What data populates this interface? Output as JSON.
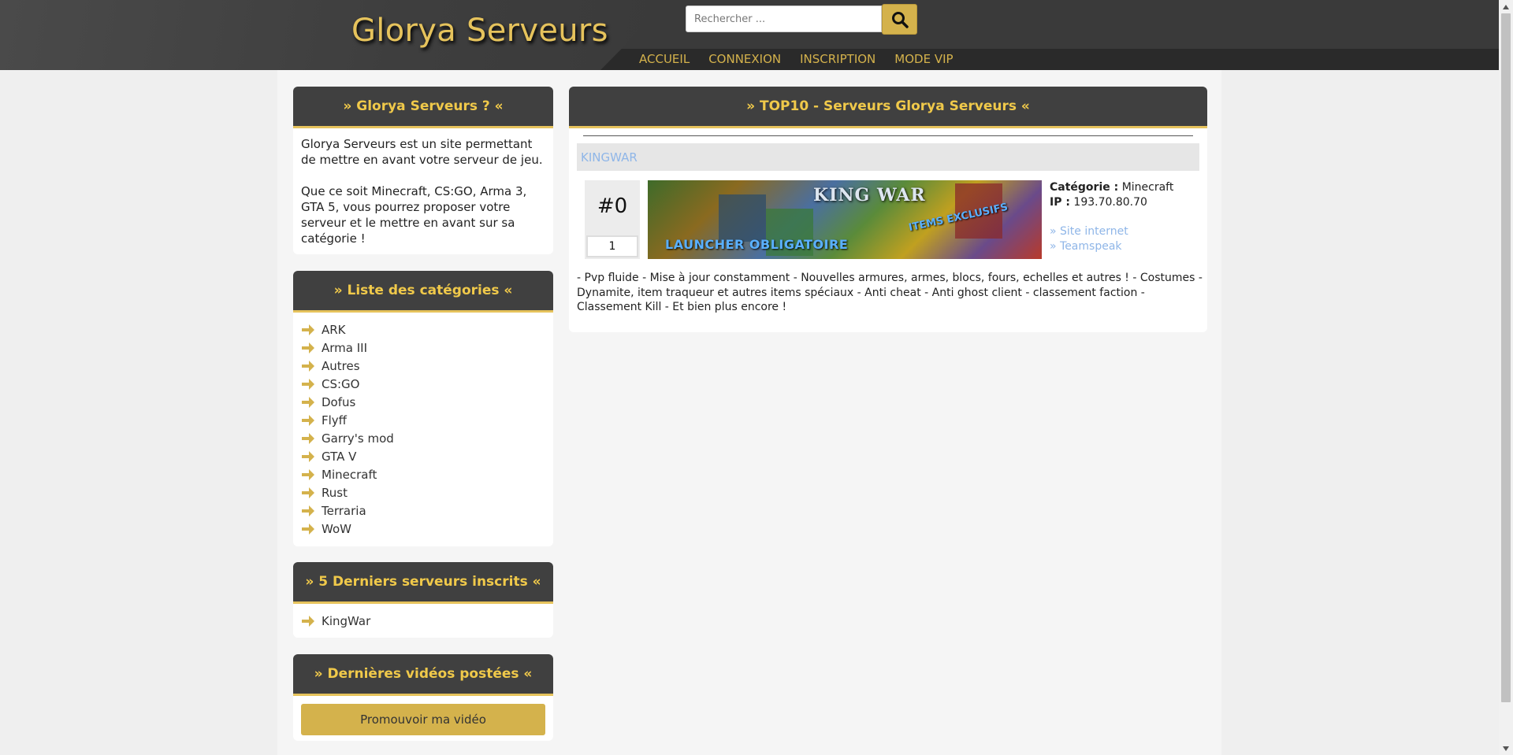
{
  "header": {
    "site_title": "Glorya Serveurs",
    "search_placeholder": "Rechercher ...",
    "nav": [
      "ACCUEIL",
      "CONNEXION",
      "INSCRIPTION",
      "MODE VIP"
    ]
  },
  "sidebar": {
    "about": {
      "title": "» Glorya Serveurs ? «",
      "paragraph1": "Glorya Serveurs est un site permettant de mettre en avant votre serveur de jeu.",
      "paragraph2": "Que ce soit Minecraft, CS:GO, Arma 3, GTA 5, vous pourrez proposer votre serveur et le mettre en avant sur sa catégorie !"
    },
    "categories": {
      "title": "» Liste des catégories «",
      "items": [
        "ARK",
        "Arma III",
        "Autres",
        "CS:GO",
        "Dofus",
        "Flyff",
        "Garry's mod",
        "GTA V",
        "Minecraft",
        "Rust",
        "Terraria",
        "WoW"
      ]
    },
    "latest_servers": {
      "title": "» 5 Derniers serveurs inscrits «",
      "items": [
        "KingWar"
      ]
    },
    "videos": {
      "title": "» Dernières vidéos postées «",
      "button_label": "Promouvoir ma vidéo"
    }
  },
  "top10": {
    "title": "» TOP10 - Serveurs Glorya Serveurs «",
    "server": {
      "name": "KINGWAR",
      "rank": "#0",
      "votes": "1",
      "banner_title": "KING WAR",
      "banner_text_bottom": "LAUNCHER OBLIGATOIRE",
      "banner_text_right": "ITEMS EXCLUSIFS",
      "category_label": "Catégorie :",
      "category_value": "Minecraft",
      "ip_label": "IP :",
      "ip_value": "193.70.80.70",
      "website_link": "» Site internet",
      "teamspeak_link": "» Teamspeak",
      "description": "- Pvp fluide - Mise à jour constamment - Nouvelles armures, armes, blocs, fours, echelles et autres ! - Costumes - Dynamite, item traqueur et autres items spéciaux - Anti cheat - Anti ghost client - classement faction - Classement Kill - Et bien plus encore !"
    }
  },
  "colors": {
    "accent_gold": "#d4b24c",
    "header_dark": "#373737",
    "panel_head": "#404040",
    "link_blue": "#8fb6e8"
  }
}
